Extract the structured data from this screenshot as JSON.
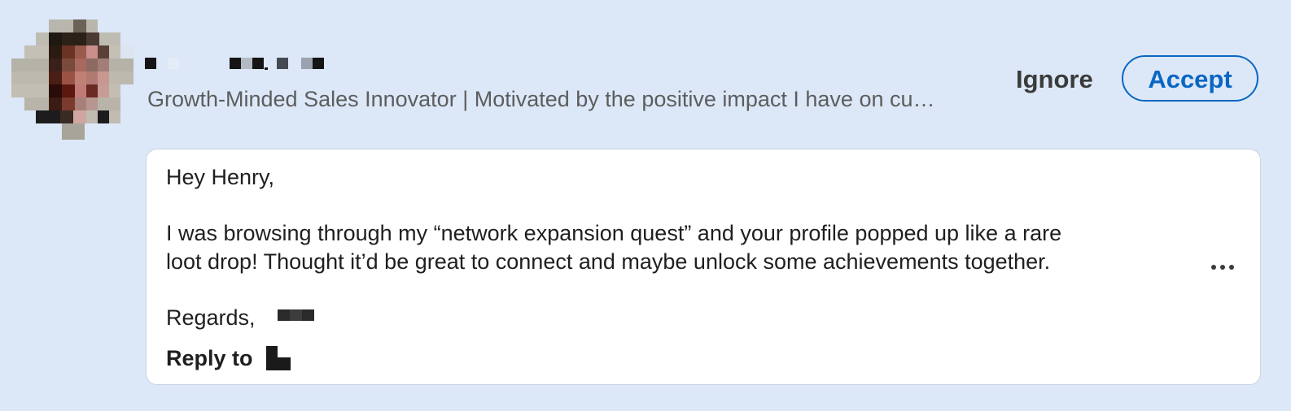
{
  "invitation": {
    "headline": "Growth-Minded Sales Innovator | Motivated by the positive impact I have on cu…",
    "actions": {
      "ignore_label": "Ignore",
      "accept_label": "Accept"
    },
    "message": {
      "greeting": "Hey Henry,",
      "body_line_1": "I was browsing through my “network expansion quest” and your profile popped up like a rare",
      "body_line_2": "loot drop! Thought it’d be great to connect and maybe unlock some achievements together.",
      "signoff": "Regards,",
      "reply_label": "Reply to",
      "more_icon": "more-horizontal-icon"
    }
  },
  "colors": {
    "background": "#dce8f8",
    "accent": "#0a66c2",
    "card": "#ffffff",
    "headline_text": "#5d5d5d"
  }
}
